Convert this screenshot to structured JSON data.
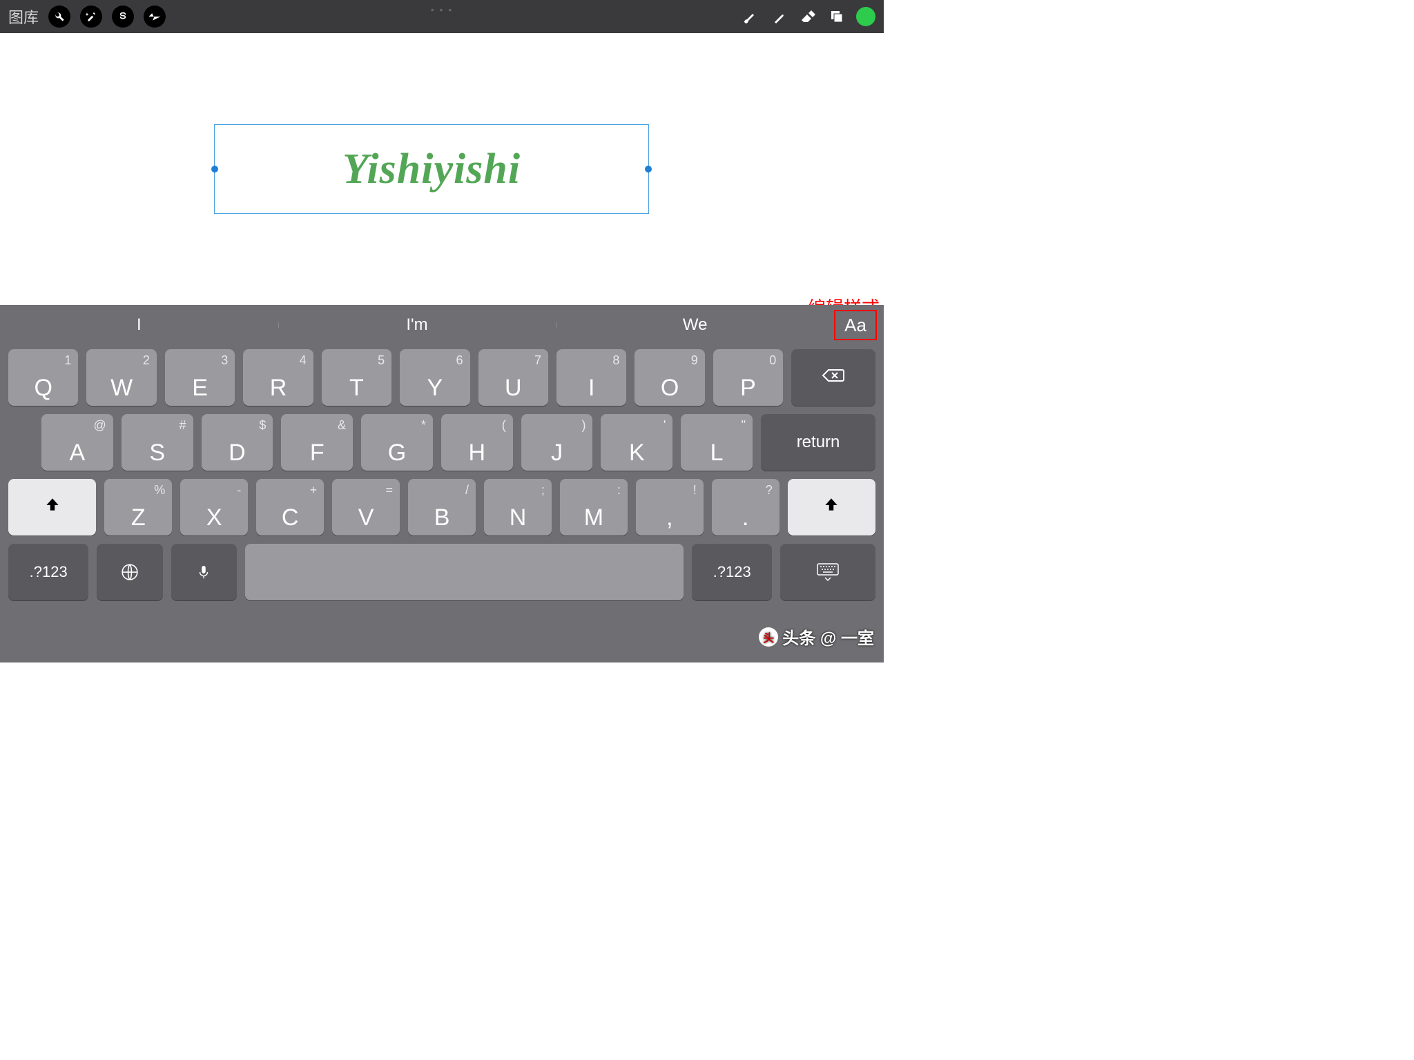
{
  "toolbar": {
    "gallery_label": "图库"
  },
  "canvas": {
    "text_value": "Yishiyishi"
  },
  "annotation": {
    "edit_style": "编辑样式"
  },
  "suggestions": {
    "s1": "I",
    "s2": "I'm",
    "s3": "We",
    "aa": "Aa"
  },
  "keys": {
    "row1": [
      {
        "sub": "1",
        "main": "Q"
      },
      {
        "sub": "2",
        "main": "W"
      },
      {
        "sub": "3",
        "main": "E"
      },
      {
        "sub": "4",
        "main": "R"
      },
      {
        "sub": "5",
        "main": "T"
      },
      {
        "sub": "6",
        "main": "Y"
      },
      {
        "sub": "7",
        "main": "U"
      },
      {
        "sub": "8",
        "main": "I"
      },
      {
        "sub": "9",
        "main": "O"
      },
      {
        "sub": "0",
        "main": "P"
      }
    ],
    "row2": [
      {
        "sub": "@",
        "main": "A"
      },
      {
        "sub": "#",
        "main": "S"
      },
      {
        "sub": "$",
        "main": "D"
      },
      {
        "sub": "&",
        "main": "F"
      },
      {
        "sub": "*",
        "main": "G"
      },
      {
        "sub": "(",
        "main": "H"
      },
      {
        "sub": ")",
        "main": "J"
      },
      {
        "sub": "'",
        "main": "K"
      },
      {
        "sub": "\"",
        "main": "L"
      }
    ],
    "return": "return",
    "row3": [
      {
        "sub": "%",
        "main": "Z"
      },
      {
        "sub": "-",
        "main": "X"
      },
      {
        "sub": "+",
        "main": "C"
      },
      {
        "sub": "=",
        "main": "V"
      },
      {
        "sub": "/",
        "main": "B"
      },
      {
        "sub": ";",
        "main": "N"
      },
      {
        "sub": ":",
        "main": "M"
      },
      {
        "sub": "!",
        "main": ","
      },
      {
        "sub": "?",
        "main": "."
      }
    ],
    "numswitch": ".?123"
  },
  "watermark": {
    "text": "头条 @ 一室"
  }
}
